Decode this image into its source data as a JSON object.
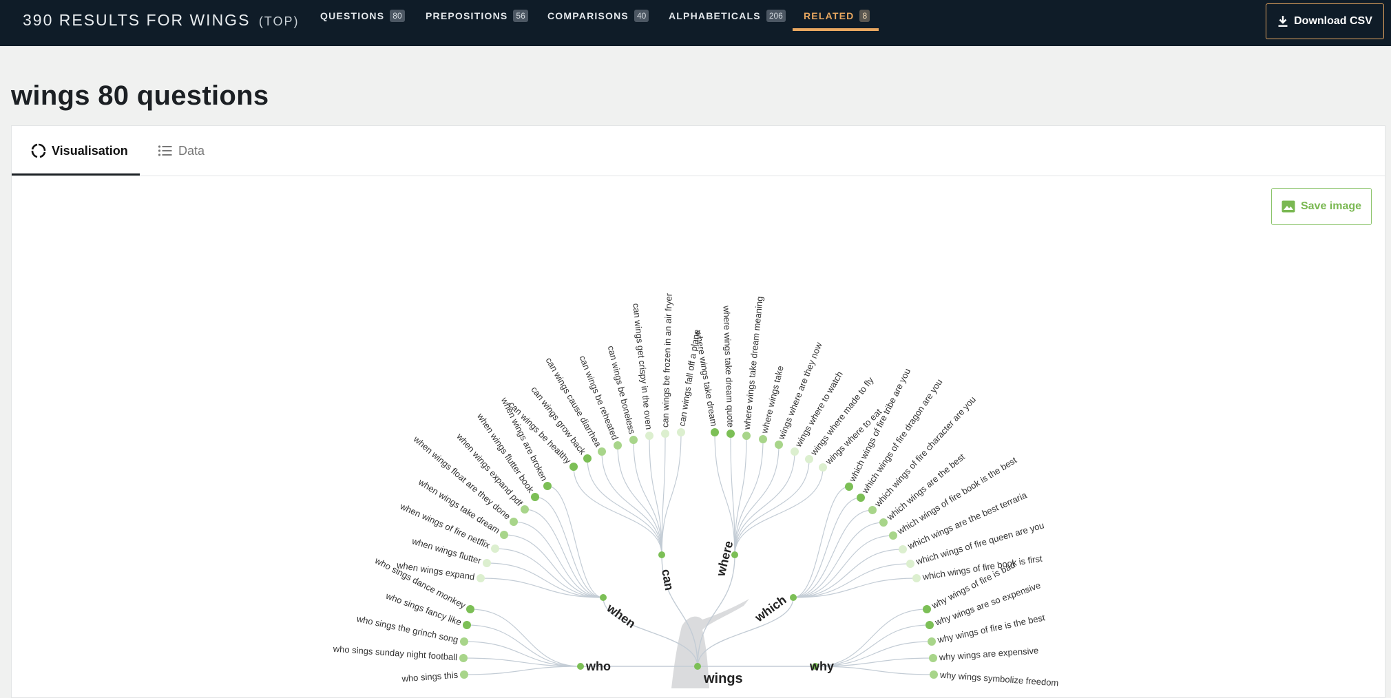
{
  "header": {
    "results_title": "390 RESULTS FOR WINGS",
    "results_suffix": "(TOP)",
    "tabs": [
      {
        "label": "QUESTIONS",
        "count": "80"
      },
      {
        "label": "PREPOSITIONS",
        "count": "56"
      },
      {
        "label": "COMPARISONS",
        "count": "40"
      },
      {
        "label": "ALPHABETICALS",
        "count": "206"
      },
      {
        "label": "RELATED",
        "count": "8"
      }
    ],
    "active_tab": "RELATED",
    "download_label": "Download CSV",
    "accent_color": "#e8a760"
  },
  "page_title": "wings 80 questions",
  "view_tabs": [
    {
      "label": "Visualisation",
      "active": true,
      "icon": "circle-loader-icon"
    },
    {
      "label": "Data",
      "active": false,
      "icon": "list-icon"
    }
  ],
  "save_label": "Save image",
  "visualisation": {
    "center_label": "wings",
    "branches": [
      {
        "label": "can",
        "leaves": [
          "can wings be healthy",
          "can wings grow back",
          "can wings cause diarrhea",
          "can wings be reheated",
          "can wings be boneless",
          "can wings get crispy in the oven",
          "can wings be frozen in an air fryer",
          "can wings fall off a plane"
        ]
      },
      {
        "label": "where",
        "leaves": [
          "where wings take dream",
          "where wings take dream quote",
          "where wings take dream meaning",
          "where wings take",
          "wings where are they now",
          "wings where to watch",
          "wings where made to fly",
          "wings where to eat"
        ]
      },
      {
        "label": "when",
        "leaves": [
          "when wings are broken",
          "when wings flutter book",
          "when wings expand pdf",
          "when wings float are they done",
          "when wings take dream",
          "when wings of fire netflix",
          "when wings flutter",
          "when wings expand"
        ]
      },
      {
        "label": "which",
        "leaves": [
          "which wings of fire tribe are you",
          "which wings of fire dragon are you",
          "which wings of fire character are you",
          "which wings are the best",
          "which wings of fire book is the best",
          "which wings are the best terraria",
          "which wings of fire queen are you",
          "which wings of fire book is first"
        ]
      },
      {
        "label": "who",
        "leaves": [
          "who sings dance monkey",
          "who sings fancy like",
          "who sings the grinch song",
          "who sings sunday night football",
          "who sings this"
        ]
      },
      {
        "label": "why",
        "leaves": [
          "why wings of fire is bad",
          "why wings are so expensive",
          "why wings of fire is the best",
          "why wings are expensive",
          "why wings symbolize freedom"
        ]
      }
    ],
    "colors": {
      "strong": "#7cbf56",
      "medium": "#a8d58a",
      "light": "#dcefcf",
      "link": "#c3ccd5"
    }
  }
}
